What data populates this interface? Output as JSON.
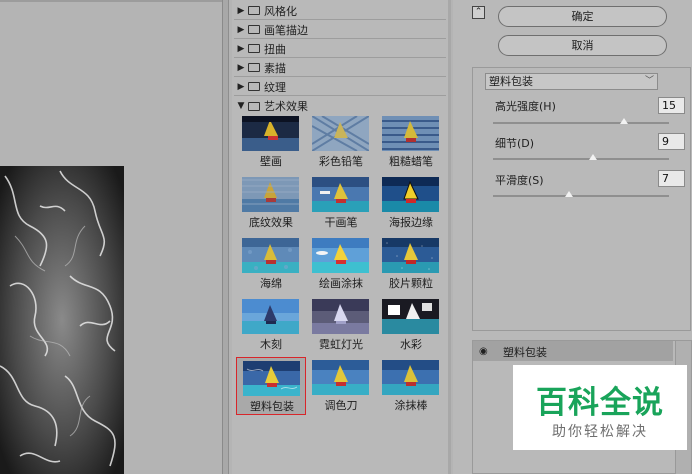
{
  "buttons": {
    "ok": "确定",
    "cancel": "取消"
  },
  "gallery": {
    "folders": [
      {
        "label": "风格化",
        "expanded": false
      },
      {
        "label": "画笔描边",
        "expanded": false
      },
      {
        "label": "扭曲",
        "expanded": false
      },
      {
        "label": "素描",
        "expanded": false
      },
      {
        "label": "纹理",
        "expanded": false
      },
      {
        "label": "艺术效果",
        "expanded": true
      }
    ],
    "filters": [
      {
        "label": "壁画"
      },
      {
        "label": "彩色铅笔"
      },
      {
        "label": "粗糙蜡笔"
      },
      {
        "label": "底纹效果"
      },
      {
        "label": "干画笔"
      },
      {
        "label": "海报边缘"
      },
      {
        "label": "海绵"
      },
      {
        "label": "绘画涂抹"
      },
      {
        "label": "胶片颗粒"
      },
      {
        "label": "木刻"
      },
      {
        "label": "霓虹灯光"
      },
      {
        "label": "水彩"
      },
      {
        "label": "塑料包装"
      },
      {
        "label": "调色刀"
      },
      {
        "label": "涂抹棒"
      }
    ],
    "selected_filter": "塑料包装"
  },
  "options": {
    "filter_select": "塑料包装",
    "params": [
      {
        "label": "高光强度(H)",
        "value": "15",
        "max": 20
      },
      {
        "label": "细节(D)",
        "value": "9",
        "max": 15
      },
      {
        "label": "平滑度(S)",
        "value": "7",
        "max": 15
      }
    ]
  },
  "layers": {
    "items": [
      {
        "name": "塑料包装"
      }
    ]
  },
  "watermark": {
    "title": "百科全说",
    "subtitle": "助你轻松解决"
  },
  "colors": {
    "selection": "#d8262a",
    "watermark_green": "#19a45a"
  }
}
